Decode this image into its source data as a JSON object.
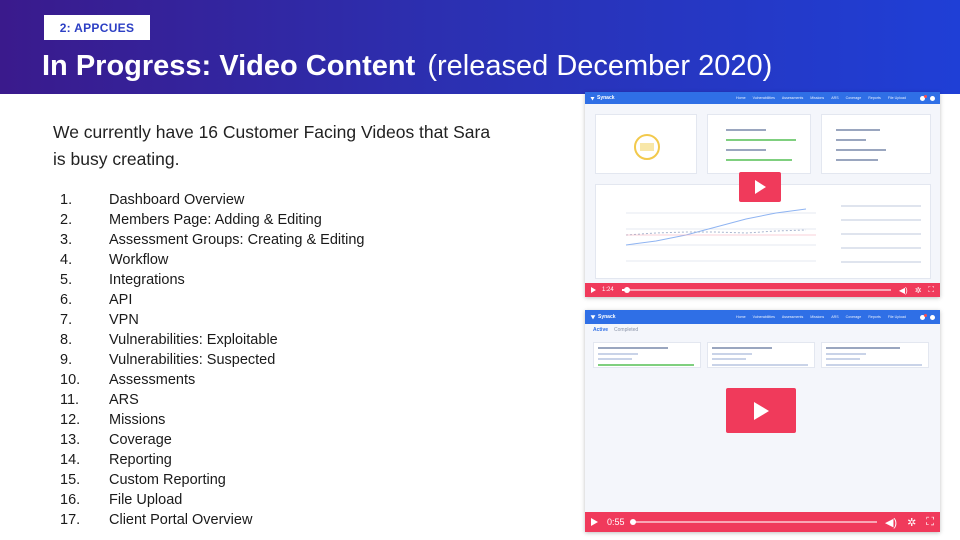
{
  "header": {
    "section_tag": "2: APPCUES",
    "title_main": "In Progress: Video Content",
    "title_sub": "(released December 2020)"
  },
  "intro_text": "We currently have 16 Customer Facing Videos that Sara is busy creating.",
  "videos": [
    {
      "num": "1.",
      "title": "Dashboard Overview"
    },
    {
      "num": "2.",
      "title": "Members Page: Adding & Editing"
    },
    {
      "num": "3.",
      "title": "Assessment Groups: Creating & Editing"
    },
    {
      "num": "4.",
      "title": "Workflow"
    },
    {
      "num": "5.",
      "title": "Integrations"
    },
    {
      "num": "6.",
      "title": "API"
    },
    {
      "num": "7.",
      "title": "VPN"
    },
    {
      "num": "8.",
      "title": "Vulnerabilities: Exploitable"
    },
    {
      "num": "9.",
      "title": "Vulnerabilities: Suspected"
    },
    {
      "num": "10.",
      "title": "Assessments"
    },
    {
      "num": "11.",
      "title": "ARS"
    },
    {
      "num": "12.",
      "title": "Missions"
    },
    {
      "num": "13.",
      "title": "Coverage"
    },
    {
      "num": "14.",
      "title": "Reporting"
    },
    {
      "num": "15.",
      "title": "Custom Reporting"
    },
    {
      "num": "16.",
      "title": "File Upload"
    },
    {
      "num": "17.",
      "title": "Client Portal Overview"
    }
  ],
  "player1": {
    "app_name": "Synack",
    "nav_links": [
      "Home",
      "Vulnerabilities",
      "Assessments",
      "Missions",
      "ARS",
      "Coverage",
      "Reports",
      "File Upload"
    ],
    "time": "1:24",
    "progress": 0.02
  },
  "player2": {
    "app_name": "Synack",
    "nav_links": [
      "Home",
      "Vulnerabilities",
      "Assessments",
      "Missions",
      "ARS",
      "Coverage",
      "Reports",
      "File Upload"
    ],
    "tabs": [
      "Active",
      "Completed"
    ],
    "time": "0:55",
    "progress": 0.0
  },
  "colors": {
    "header_start": "#3a1a8c",
    "header_end": "#1f3fd6",
    "player_accent": "#f03a5b",
    "app_nav": "#2f6fe6"
  },
  "icons": {
    "volume": "volume-icon",
    "settings": "gear-icon",
    "fullscreen": "fullscreen-icon",
    "play": "play-icon"
  }
}
